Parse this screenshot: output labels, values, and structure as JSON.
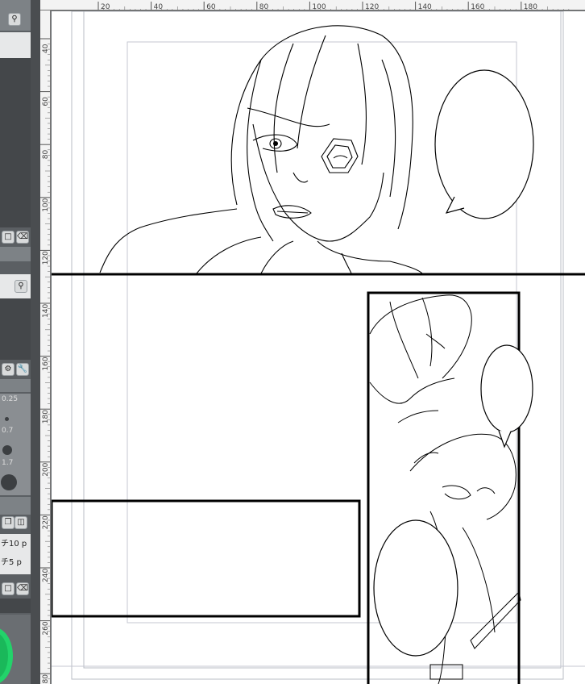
{
  "left_panel": {
    "brush_sizes": [
      "0.25",
      "0.7",
      "1",
      "1.7",
      "2"
    ],
    "labels": [
      "チ10 p",
      "チ5 p"
    ]
  },
  "ruler": {
    "top_labels": [
      "20",
      "40",
      "60",
      "80",
      "100",
      "120",
      "140",
      "160",
      "180"
    ],
    "left_labels": [
      "40",
      "60",
      "80",
      "100",
      "120",
      "140",
      "160",
      "180",
      "200",
      "220",
      "240",
      "260",
      "280"
    ]
  },
  "colors": {
    "panel_bg": "#595d61",
    "ruler_bg": "#f3f3f3",
    "canvas_bg": "#ffffff",
    "guide_line": "#a8b4d8",
    "ink": "#000000",
    "accent_green": "#2ecc71"
  },
  "icons": [
    "search-icon",
    "settings-icon",
    "trash-icon",
    "layer-icon",
    "gear-icon",
    "wrench-icon"
  ]
}
